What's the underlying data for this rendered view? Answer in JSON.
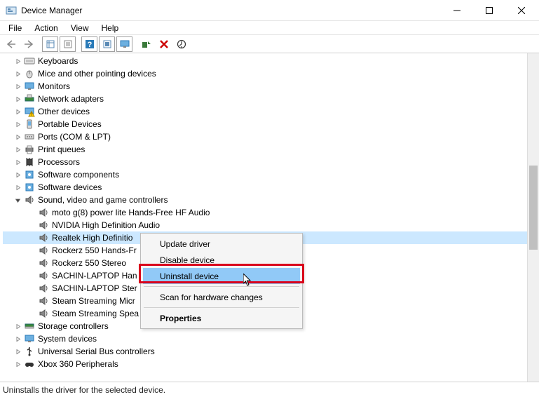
{
  "window": {
    "title": "Device Manager"
  },
  "menubar": [
    "File",
    "Action",
    "View",
    "Help"
  ],
  "toolbar_icons": [
    "back",
    "forward",
    "show-hidden",
    "properties",
    "help",
    "update",
    "monitor",
    "scan",
    "uninstall",
    "devices"
  ],
  "tree": {
    "categories": [
      {
        "label": "Keyboards",
        "icon": "keyboard-icon",
        "expanded": false,
        "children": []
      },
      {
        "label": "Mice and other pointing devices",
        "icon": "mouse-icon",
        "expanded": false,
        "children": []
      },
      {
        "label": "Monitors",
        "icon": "monitor-icon",
        "expanded": false,
        "children": []
      },
      {
        "label": "Network adapters",
        "icon": "network-icon",
        "expanded": false,
        "children": []
      },
      {
        "label": "Other devices",
        "icon": "warning-icon",
        "expanded": false,
        "children": []
      },
      {
        "label": "Portable Devices",
        "icon": "portable-icon",
        "expanded": false,
        "children": []
      },
      {
        "label": "Ports (COM & LPT)",
        "icon": "port-icon",
        "expanded": false,
        "children": []
      },
      {
        "label": "Print queues",
        "icon": "printer-icon",
        "expanded": false,
        "children": []
      },
      {
        "label": "Processors",
        "icon": "cpu-icon",
        "expanded": false,
        "children": []
      },
      {
        "label": "Software components",
        "icon": "component-icon",
        "expanded": false,
        "children": []
      },
      {
        "label": "Software devices",
        "icon": "component-icon",
        "expanded": false,
        "children": []
      },
      {
        "label": "Sound, video and game controllers",
        "icon": "speaker-icon",
        "expanded": true,
        "children": [
          {
            "label": "moto g(8) power lite Hands-Free HF Audio",
            "selected": false
          },
          {
            "label": "NVIDIA High Definition Audio",
            "selected": false
          },
          {
            "label": "Realtek High Definitio",
            "selected": true
          },
          {
            "label": "Rockerz 550 Hands-Fr",
            "selected": false
          },
          {
            "label": "Rockerz 550 Stereo",
            "selected": false
          },
          {
            "label": "SACHIN-LAPTOP Han",
            "selected": false
          },
          {
            "label": "SACHIN-LAPTOP Ster",
            "selected": false
          },
          {
            "label": "Steam Streaming Micr",
            "selected": false
          },
          {
            "label": "Steam Streaming Spea",
            "selected": false
          }
        ]
      },
      {
        "label": "Storage controllers",
        "icon": "storage-icon",
        "expanded": false,
        "children": []
      },
      {
        "label": "System devices",
        "icon": "system-icon",
        "expanded": false,
        "children": []
      },
      {
        "label": "Universal Serial Bus controllers",
        "icon": "usb-icon",
        "expanded": false,
        "children": []
      },
      {
        "label": "Xbox 360 Peripherals",
        "icon": "gamepad-icon",
        "expanded": false,
        "children": []
      }
    ]
  },
  "context_menu": {
    "items": [
      {
        "label": "Update driver",
        "hover": false
      },
      {
        "label": "Disable device",
        "hover": false
      },
      {
        "label": "Uninstall device",
        "hover": true
      },
      {
        "sep": true
      },
      {
        "label": "Scan for hardware changes",
        "hover": false
      },
      {
        "sep": true
      },
      {
        "label": "Properties",
        "bold": true,
        "hover": false
      }
    ]
  },
  "statusbar": {
    "text": "Uninstalls the driver for the selected device."
  }
}
